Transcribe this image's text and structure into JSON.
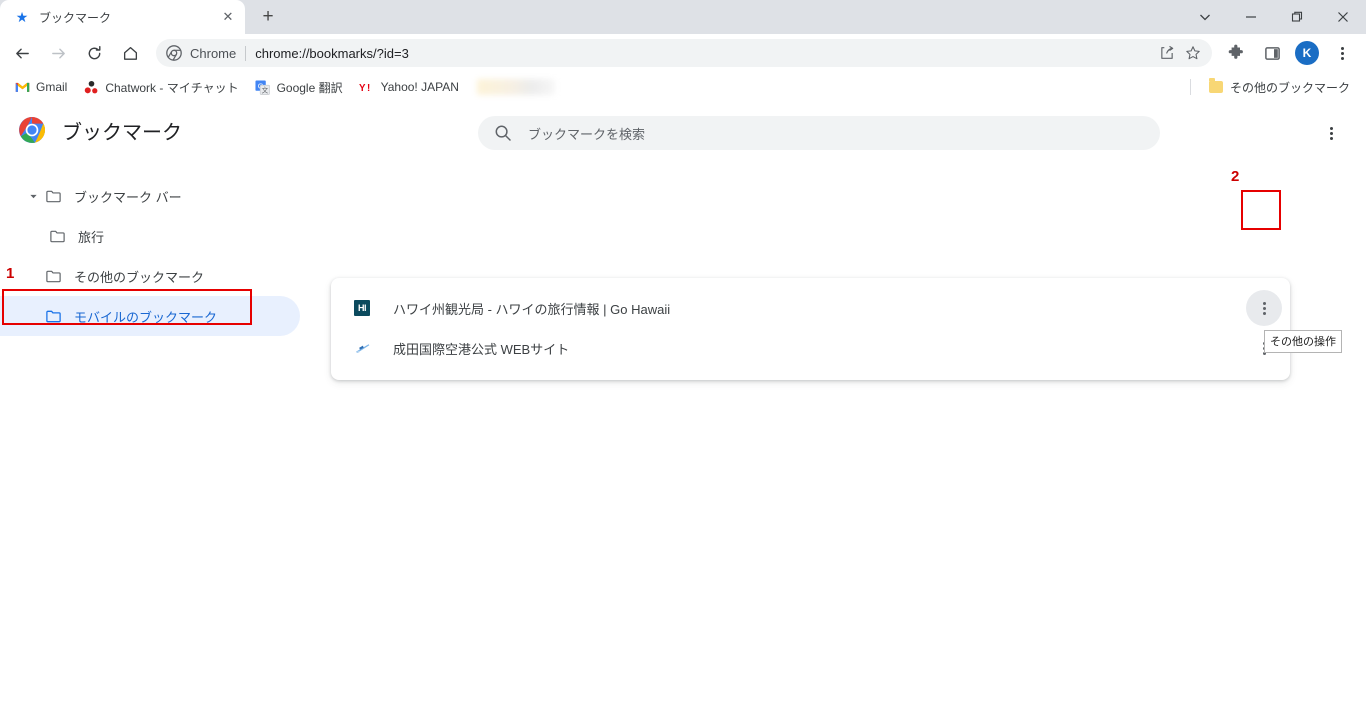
{
  "window": {
    "controls": {
      "minimize": "−",
      "maximize": "□",
      "close": "✕",
      "tablist": "∨"
    }
  },
  "tabstrip": {
    "tabs": [
      {
        "title": "ブックマーク",
        "favicon": "star-icon",
        "close_label": "✕"
      }
    ],
    "new_tab_label": "+"
  },
  "toolbar": {
    "back": "←",
    "forward": "→",
    "reload": "⟳",
    "home": "⌂",
    "omnibox": {
      "scheme_label": "Chrome",
      "url": "chrome://bookmarks/?id=3",
      "share_icon": "share-icon",
      "bookmark_star_icon": "star-outline-icon"
    },
    "extensions_icon": "puzzle-icon",
    "side_panel_icon": "side-panel-icon",
    "avatar_letter": "K",
    "menu_icon": "three-dots-icon"
  },
  "bookmarks_bar": {
    "items": [
      {
        "label": "Gmail",
        "icon": "gmail-icon"
      },
      {
        "label": "Chatwork - マイチャット",
        "icon": "chatwork-icon"
      },
      {
        "label": "Google 翻訳",
        "icon": "google-translate-icon"
      },
      {
        "label": "Yahoo! JAPAN",
        "icon": "yahoo-japan-icon"
      },
      {
        "label": "",
        "icon": "blurred-item"
      }
    ],
    "other_bookmarks_label": "その他のブックマーク"
  },
  "page": {
    "title": "ブックマーク",
    "logo": "chrome-logo",
    "search": {
      "placeholder": "ブックマークを検索",
      "value": "",
      "icon": "search-icon"
    },
    "overflow_menu_icon": "three-dots-icon"
  },
  "sidebar": {
    "items": [
      {
        "label": "ブックマーク バー",
        "expanded": true,
        "selected": false,
        "level": 0
      },
      {
        "label": "旅行",
        "expanded": false,
        "selected": false,
        "level": 1
      },
      {
        "label": "その他のブックマーク",
        "expanded": false,
        "selected": false,
        "level": 0
      },
      {
        "label": "モバイルのブックマーク",
        "expanded": false,
        "selected": true,
        "level": 0
      }
    ]
  },
  "bookmark_list": {
    "rows": [
      {
        "title": "ハワイ州観光局 - ハワイの旅行情報 | Go Hawaii",
        "favicon": "hawaii-icon",
        "favicon_text": "HI",
        "menu_icon": "three-dots-icon",
        "menu_hovered": true
      },
      {
        "title": "成田国際空港公式 WEBサイト",
        "favicon": "narita-airport-icon",
        "favicon_text": "",
        "menu_icon": "three-dots-icon",
        "menu_hovered": false
      }
    ]
  },
  "tooltip": {
    "text": "その他の操作"
  },
  "annotations": [
    {
      "number": "1",
      "target": "sidebar-item-mobile-bookmarks"
    },
    {
      "number": "2",
      "target": "bookmark-row-menu"
    }
  ],
  "colors": {
    "accent_blue": "#1a73e8",
    "selected_bg": "#e8f0fe",
    "selected_text": "#1967d2",
    "annotation_red": "#e60000",
    "tabstrip_bg": "#dee1e6",
    "omnibox_bg": "#f1f3f4"
  }
}
